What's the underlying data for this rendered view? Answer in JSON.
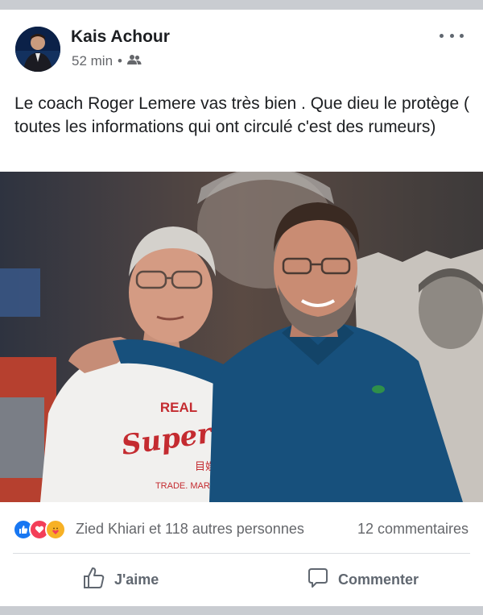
{
  "post": {
    "author": "Kais Achour",
    "time": "52 min",
    "separator": "•",
    "audience_icon": "friends-icon",
    "text": "Le coach Roger Lemere vas très bien . Que dieu le protège ( toutes les informations qui ont circulé c'est des rumeurs)",
    "photo_shirt_text": {
      "line1": "REAL",
      "line2": "SuperDr",
      "line3": "目娱乐节",
      "line4": "TRADE. MARK. JP"
    }
  },
  "reactions": {
    "icons": [
      "like-icon",
      "love-icon",
      "care-icon"
    ],
    "summary": "Zied Khiari et 118 autres personnes",
    "comments": "12 commentaires"
  },
  "actions": {
    "like_label": "J'aime",
    "comment_label": "Commenter"
  },
  "colors": {
    "like_blue": "#1877f2",
    "love_red": "#f33e58",
    "care_yellow": "#f7b125",
    "text_primary": "#1c1e21",
    "text_secondary": "#65676b"
  }
}
